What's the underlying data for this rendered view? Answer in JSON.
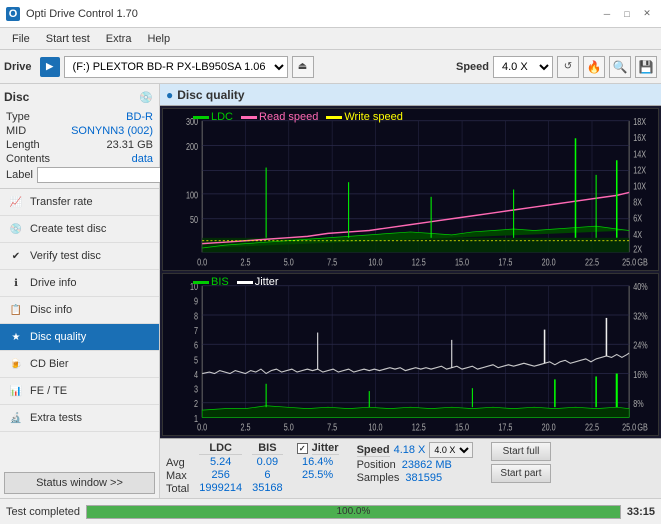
{
  "titlebar": {
    "title": "Opti Drive Control 1.70",
    "icon": "O",
    "minimize": "─",
    "maximize": "□",
    "close": "✕"
  },
  "menubar": {
    "items": [
      "File",
      "Start test",
      "Extra",
      "Help"
    ]
  },
  "toolbar": {
    "drive_label": "Drive",
    "drive_value": "(F:) PLEXTOR BD-R  PX-LB950SA 1.06",
    "speed_label": "Speed",
    "speed_value": "4.0 X"
  },
  "disc": {
    "label": "Disc",
    "type_key": "Type",
    "type_val": "BD-R",
    "mid_key": "MID",
    "mid_val": "SONYNN3 (002)",
    "length_key": "Length",
    "length_val": "23.31 GB",
    "contents_key": "Contents",
    "contents_val": "data",
    "label_key": "Label",
    "label_val": ""
  },
  "nav": {
    "items": [
      {
        "id": "transfer-rate",
        "label": "Transfer rate",
        "icon": "📈"
      },
      {
        "id": "create-test-disc",
        "label": "Create test disc",
        "icon": "💿"
      },
      {
        "id": "verify-test-disc",
        "label": "Verify test disc",
        "icon": "✔"
      },
      {
        "id": "drive-info",
        "label": "Drive info",
        "icon": "ℹ"
      },
      {
        "id": "disc-info",
        "label": "Disc info",
        "icon": "📋"
      },
      {
        "id": "disc-quality",
        "label": "Disc quality",
        "icon": "★",
        "active": true
      },
      {
        "id": "cd-bier",
        "label": "CD Bier",
        "icon": "🍺"
      },
      {
        "id": "fe-te",
        "label": "FE / TE",
        "icon": "📊"
      },
      {
        "id": "extra-tests",
        "label": "Extra tests",
        "icon": "🔬"
      }
    ],
    "status_button": "Status window >>"
  },
  "content": {
    "title": "Disc quality"
  },
  "chart_top": {
    "legend": [
      {
        "label": "LDC",
        "color": "#00cc00"
      },
      {
        "label": "Read speed",
        "color": "#ff69b4"
      },
      {
        "label": "Write speed",
        "color": "#ffff00"
      }
    ],
    "y_max": 300,
    "x_max": 25,
    "right_labels": [
      "18X",
      "16X",
      "14X",
      "12X",
      "10X",
      "8X",
      "6X",
      "4X",
      "2X"
    ]
  },
  "chart_bottom": {
    "legend": [
      {
        "label": "BIS",
        "color": "#00cc00"
      },
      {
        "label": "Jitter",
        "color": "#ffffff"
      }
    ],
    "y_max": 10,
    "x_max": 25,
    "right_labels": [
      "40%",
      "32%",
      "24%",
      "16%",
      "8%"
    ]
  },
  "stats": {
    "ldc_header": "LDC",
    "bis_header": "BIS",
    "jitter_header": "Jitter",
    "speed_header": "Speed",
    "rows": [
      {
        "label": "Avg",
        "ldc": "5.24",
        "bis": "0.09",
        "jitter": "16.4%"
      },
      {
        "label": "Max",
        "ldc": "256",
        "bis": "6",
        "jitter": "25.5%"
      },
      {
        "label": "Total",
        "ldc": "1999214",
        "bis": "35168",
        "jitter": ""
      }
    ],
    "speed_val": "4.18 X",
    "speed_select": "4.0 X",
    "position_label": "Position",
    "position_val": "23862 MB",
    "samples_label": "Samples",
    "samples_val": "381595",
    "jitter_checked": true,
    "start_full": "Start full",
    "start_part": "Start part"
  },
  "statusbar": {
    "text": "Test completed",
    "progress": 100,
    "progress_text": "100.0%",
    "time": "33:15"
  }
}
